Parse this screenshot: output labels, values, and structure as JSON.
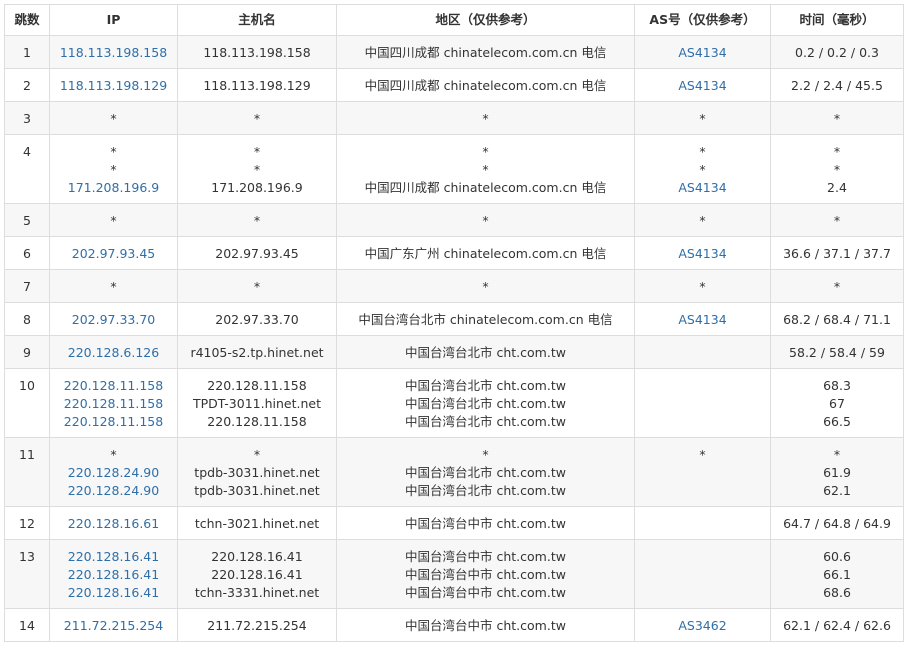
{
  "headers": {
    "hop": "跳数",
    "ip": "IP",
    "host": "主机名",
    "region": "地区（仅供参考）",
    "as": "AS号（仅供参考）",
    "time": "时间（毫秒）"
  },
  "colors": {
    "link": "#2f6fa9",
    "border": "#dddddd",
    "stripe": "#f7f7f7"
  },
  "rows": [
    {
      "hop": "1",
      "ip": [
        "118.113.198.158"
      ],
      "host": [
        "118.113.198.158"
      ],
      "region": [
        "中国四川成都 chinatelecom.com.cn 电信"
      ],
      "as": [
        "AS4134"
      ],
      "time": [
        "0.2 / 0.2 / 0.3"
      ]
    },
    {
      "hop": "2",
      "ip": [
        "118.113.198.129"
      ],
      "host": [
        "118.113.198.129"
      ],
      "region": [
        "中国四川成都 chinatelecom.com.cn 电信"
      ],
      "as": [
        "AS4134"
      ],
      "time": [
        "2.2 / 2.4 / 45.5"
      ]
    },
    {
      "hop": "3",
      "ip": [
        "*"
      ],
      "host": [
        "*"
      ],
      "region": [
        "*"
      ],
      "as": [
        "*"
      ],
      "time": [
        "*"
      ]
    },
    {
      "hop": "4",
      "ip": [
        "*",
        "*",
        "171.208.196.9"
      ],
      "host": [
        "*",
        "*",
        "171.208.196.9"
      ],
      "region": [
        "*",
        "*",
        "中国四川成都 chinatelecom.com.cn 电信"
      ],
      "as": [
        "*",
        "*",
        "AS4134"
      ],
      "time": [
        "*",
        "*",
        "2.4"
      ]
    },
    {
      "hop": "5",
      "ip": [
        "*"
      ],
      "host": [
        "*"
      ],
      "region": [
        "*"
      ],
      "as": [
        "*"
      ],
      "time": [
        "*"
      ]
    },
    {
      "hop": "6",
      "ip": [
        "202.97.93.45"
      ],
      "host": [
        "202.97.93.45"
      ],
      "region": [
        "中国广东广州 chinatelecom.com.cn 电信"
      ],
      "as": [
        "AS4134"
      ],
      "time": [
        "36.6 / 37.1 / 37.7"
      ]
    },
    {
      "hop": "7",
      "ip": [
        "*"
      ],
      "host": [
        "*"
      ],
      "region": [
        "*"
      ],
      "as": [
        "*"
      ],
      "time": [
        "*"
      ]
    },
    {
      "hop": "8",
      "ip": [
        "202.97.33.70"
      ],
      "host": [
        "202.97.33.70"
      ],
      "region": [
        "中国台湾台北市 chinatelecom.com.cn 电信"
      ],
      "as": [
        "AS4134"
      ],
      "time": [
        "68.2 / 68.4 / 71.1"
      ]
    },
    {
      "hop": "9",
      "ip": [
        "220.128.6.126"
      ],
      "host": [
        "r4105-s2.tp.hinet.net"
      ],
      "region": [
        "中国台湾台北市 cht.com.tw"
      ],
      "as": [
        ""
      ],
      "time": [
        "58.2 / 58.4 / 59"
      ]
    },
    {
      "hop": "10",
      "ip": [
        "220.128.11.158",
        "220.128.11.158",
        "220.128.11.158"
      ],
      "host": [
        "220.128.11.158",
        "TPDT-3011.hinet.net",
        "220.128.11.158"
      ],
      "region": [
        "中国台湾台北市 cht.com.tw",
        "中国台湾台北市 cht.com.tw",
        "中国台湾台北市 cht.com.tw"
      ],
      "as": [
        "",
        "",
        ""
      ],
      "time": [
        "68.3",
        "67",
        "66.5"
      ]
    },
    {
      "hop": "11",
      "ip": [
        "*",
        "220.128.24.90",
        "220.128.24.90"
      ],
      "host": [
        "*",
        "tpdb-3031.hinet.net",
        "tpdb-3031.hinet.net"
      ],
      "region": [
        "*",
        "中国台湾台北市 cht.com.tw",
        "中国台湾台北市 cht.com.tw"
      ],
      "as": [
        "*",
        "",
        ""
      ],
      "time": [
        "*",
        "61.9",
        "62.1"
      ]
    },
    {
      "hop": "12",
      "ip": [
        "220.128.16.61"
      ],
      "host": [
        "tchn-3021.hinet.net"
      ],
      "region": [
        "中国台湾台中市 cht.com.tw"
      ],
      "as": [
        ""
      ],
      "time": [
        "64.7 / 64.8 / 64.9"
      ]
    },
    {
      "hop": "13",
      "ip": [
        "220.128.16.41",
        "220.128.16.41",
        "220.128.16.41"
      ],
      "host": [
        "220.128.16.41",
        "220.128.16.41",
        "tchn-3331.hinet.net"
      ],
      "region": [
        "中国台湾台中市 cht.com.tw",
        "中国台湾台中市 cht.com.tw",
        "中国台湾台中市 cht.com.tw"
      ],
      "as": [
        "",
        "",
        ""
      ],
      "time": [
        "60.6",
        "66.1",
        "68.6"
      ]
    },
    {
      "hop": "14",
      "ip": [
        "211.72.215.254"
      ],
      "host": [
        "211.72.215.254"
      ],
      "region": [
        "中国台湾台中市 cht.com.tw"
      ],
      "as": [
        "AS3462"
      ],
      "time": [
        "62.1 / 62.4 / 62.6"
      ]
    }
  ]
}
